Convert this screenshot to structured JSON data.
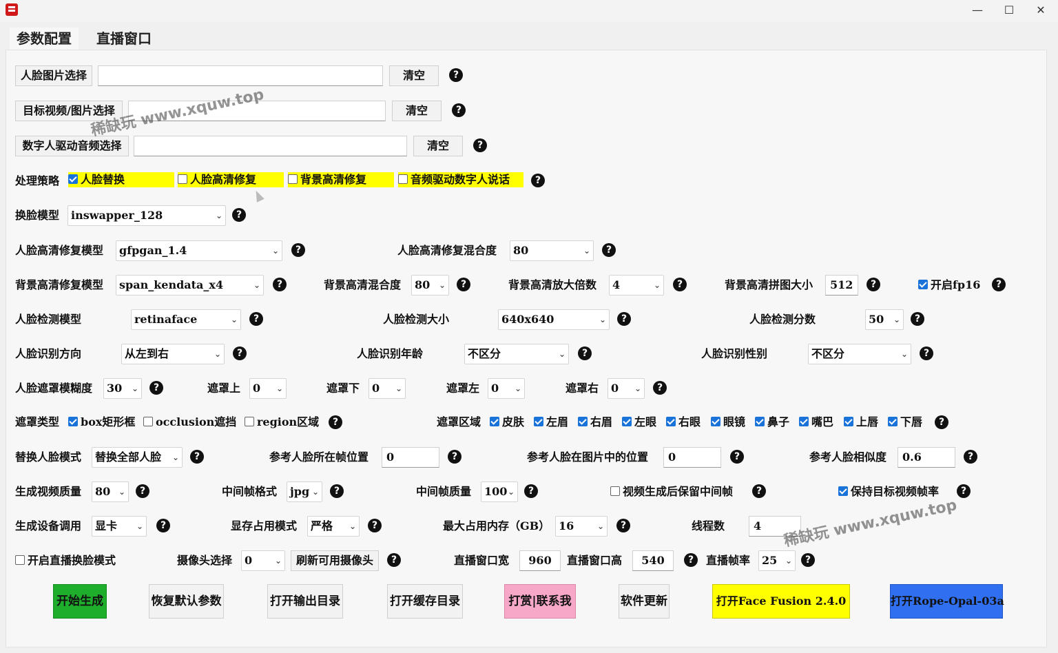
{
  "window": {
    "minimize": "—",
    "maximize": "☐",
    "close": "✕"
  },
  "tabs": [
    "参数配置",
    "直播窗口"
  ],
  "row1": {
    "select": "人脸图片选择",
    "value": "",
    "clear": "清空"
  },
  "row2": {
    "select": "目标视频/图片选择",
    "value": "",
    "clear": "清空"
  },
  "row3": {
    "select": "数字人驱动音频选择",
    "value": "",
    "clear": "清空"
  },
  "strategy": {
    "label": "处理策略",
    "options": [
      {
        "label": "人脸替换",
        "checked": true
      },
      {
        "label": "人脸高清修复",
        "checked": false
      },
      {
        "label": "背景高清修复",
        "checked": false
      },
      {
        "label": "音频驱动数字人说话",
        "checked": false
      }
    ]
  },
  "swap_model": {
    "label": "换脸模型",
    "value": "inswapper_128"
  },
  "face_enhance": {
    "label": "人脸高清修复模型",
    "value": "gfpgan_1.4",
    "blend_label": "人脸高清修复混合度",
    "blend_value": "80"
  },
  "bg_enhance": {
    "label": "背景高清修复模型",
    "value": "span_kendata_x4",
    "blend_label": "背景高清混合度",
    "blend_value": "80",
    "scale_label": "背景高清放大倍数",
    "scale_value": "4",
    "tile_label": "背景高清拼图大小",
    "tile_value": "512",
    "fp16_label": "开启fp16",
    "fp16_checked": true
  },
  "detect": {
    "model_label": "人脸检测模型",
    "model_value": "retinaface",
    "size_label": "人脸检测大小",
    "size_value": "640x640",
    "score_label": "人脸检测分数",
    "score_value": "50"
  },
  "recog": {
    "dir_label": "人脸识别方向",
    "dir_value": "从左到右",
    "age_label": "人脸识别年龄",
    "age_value": "不区分",
    "gender_label": "人脸识别性别",
    "gender_value": "不区分"
  },
  "mask": {
    "blur_label": "人脸遮罩模糊度",
    "blur_value": "30",
    "top_label": "遮罩上",
    "top_value": "0",
    "bottom_label": "遮罩下",
    "bottom_value": "0",
    "left_label": "遮罩左",
    "left_value": "0",
    "right_label": "遮罩右",
    "right_value": "0"
  },
  "mask_type": {
    "label": "遮罩类型",
    "types": [
      {
        "label": "box矩形框",
        "checked": true
      },
      {
        "label": "occlusion遮挡",
        "checked": false
      },
      {
        "label": "region区域",
        "checked": false
      }
    ],
    "region_label": "遮罩区域",
    "regions": [
      {
        "label": "皮肤",
        "checked": true
      },
      {
        "label": "左眉",
        "checked": true
      },
      {
        "label": "右眉",
        "checked": true
      },
      {
        "label": "左眼",
        "checked": true
      },
      {
        "label": "右眼",
        "checked": true
      },
      {
        "label": "眼镜",
        "checked": true
      },
      {
        "label": "鼻子",
        "checked": true
      },
      {
        "label": "嘴巴",
        "checked": true
      },
      {
        "label": "上唇",
        "checked": true
      },
      {
        "label": "下唇",
        "checked": true
      }
    ]
  },
  "replace": {
    "mode_label": "替换人脸模式",
    "mode_value": "替换全部人脸",
    "frame_label": "参考人脸所在帧位置",
    "frame_value": "0",
    "pos_label": "参考人脸在图片中的位置",
    "pos_value": "0",
    "sim_label": "参考人脸相似度",
    "sim_value": "0.6"
  },
  "output": {
    "quality_label": "生成视频质量",
    "quality_value": "80",
    "fmt_label": "中间帧格式",
    "fmt_value": "jpg",
    "fq_label": "中间帧质量",
    "fq_value": "100",
    "keep_label": "视频生成后保留中间帧",
    "keep_checked": false,
    "fps_label": "保持目标视频帧率",
    "fps_checked": true
  },
  "device": {
    "label": "生成设备调用",
    "value": "显卡",
    "vram_label": "显存占用模式",
    "vram_value": "严格",
    "mem_label": "最大占用内存（GB）",
    "mem_value": "16",
    "threads_label": "线程数",
    "threads_value": "4"
  },
  "live": {
    "mode_label": "开启直播换脸模式",
    "mode_checked": false,
    "cam_label": "摄像头选择",
    "cam_value": "0",
    "refresh_label": "刷新可用摄像头",
    "w_label": "直播窗口宽",
    "w_value": "960",
    "h_label": "直播窗口高",
    "h_value": "540",
    "fps_label": "直播帧率",
    "fps_value": "25"
  },
  "actions": [
    "开始生成",
    "恢复默认参数",
    "打开输出目录",
    "打开缓存目录",
    "打赏|联系我",
    "软件更新",
    "打开Face Fusion 2.4.0",
    "打开Rope-Opal-03a"
  ],
  "colors": {
    "start": "#1fad2c",
    "donate": "#f7a8c8",
    "facefusion": "#ffff00",
    "rope": "#2f6ff0"
  },
  "watermark": "稀缺玩 www.xquw.top",
  "help_glyph": "?",
  "arrow_glyph": "⌄"
}
